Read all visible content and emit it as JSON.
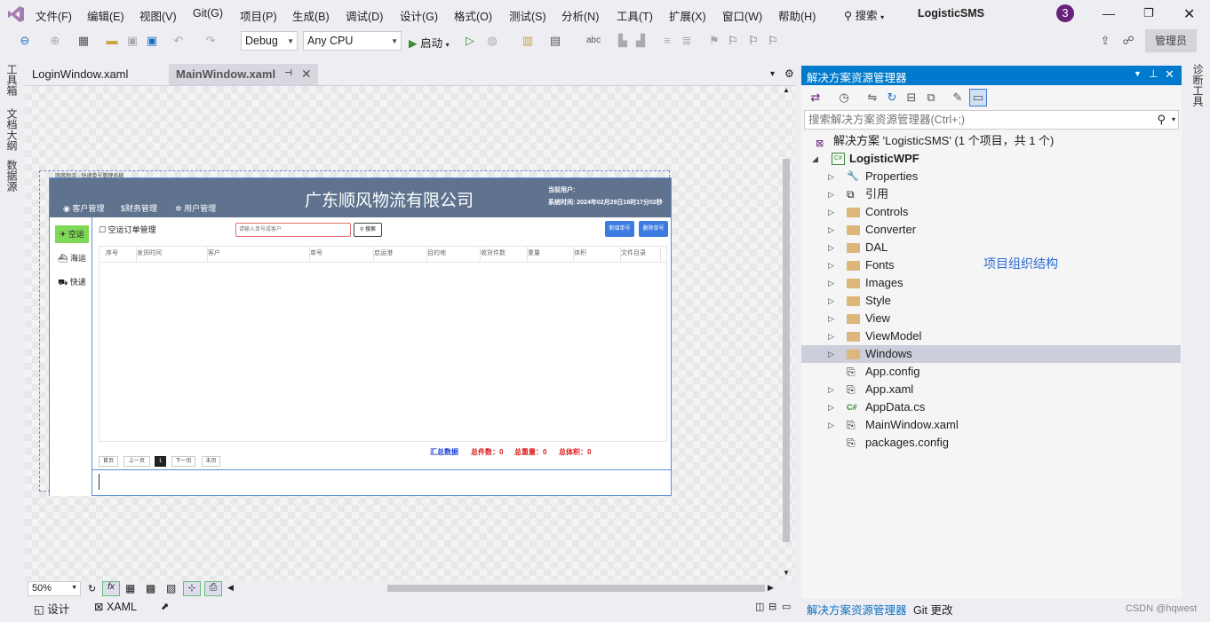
{
  "menu": {
    "items": [
      "文件(F)",
      "编辑(E)",
      "视图(V)",
      "Git(G)",
      "项目(P)",
      "生成(B)",
      "调试(D)",
      "设计(G)",
      "格式(O)",
      "测试(S)",
      "分析(N)",
      "工具(T)",
      "扩展(X)",
      "窗口(W)",
      "帮助(H)"
    ],
    "search": "搜索",
    "app_title": "LogisticSMS",
    "notification_count": "3",
    "admin_label": "管理员"
  },
  "toolbar": {
    "config": "Debug",
    "platform": "Any CPU",
    "start_label": "启动"
  },
  "left_side_tabs": [
    "工具箱",
    "文档大纲",
    "数据源"
  ],
  "right_side_tabs": [
    "诊断工具"
  ],
  "editor_tabs": [
    {
      "label": "LoginWindow.xaml"
    },
    {
      "label": "MainWindow.xaml"
    }
  ],
  "wpf_window": {
    "title_caption": "顺风物流 - 快递单号管理系统",
    "company_title": "广东顺风物流有限公司",
    "current_user_label": "当前用户:",
    "system_time": "系统时间:  2024年02月29日16时17分02秒",
    "top_nav": [
      "客户管理",
      "财务管理",
      "用户管理"
    ],
    "side_nav": [
      "空运",
      "海运",
      "快递"
    ],
    "section_title": "空运订单管理",
    "search_placeholder": "请输入单号或客户",
    "search_button": "搜索",
    "add_button": "新增单号",
    "delete_button": "删除单号",
    "columns": [
      "序号",
      "发货时间",
      "客户",
      "单号",
      "启运港",
      "目的地",
      "收货件数",
      "重量",
      "体积",
      "文件目录"
    ],
    "pager": [
      "首页",
      "上一页",
      "1",
      "下一页",
      "末页"
    ],
    "summary": {
      "label": "汇总数据",
      "total_count": "总件数：0",
      "total_weight": "总重量：0",
      "total_volume": "总体积：0"
    }
  },
  "designer_bottom": {
    "zoom": "50%",
    "design_tab": "设计",
    "xaml_tab": "XAML"
  },
  "solution_explorer": {
    "title": "解决方案资源管理器",
    "search_placeholder": "搜索解决方案资源管理器(Ctrl+;)",
    "solution": "解决方案 'LogisticSMS' (1 个项目，共 1 个)",
    "project": "LogisticWPF",
    "items": [
      {
        "label": "Properties",
        "type": "wrench",
        "expandable": true
      },
      {
        "label": "引用",
        "type": "ref",
        "expandable": true
      },
      {
        "label": "Controls",
        "type": "folder",
        "expandable": true
      },
      {
        "label": "Converter",
        "type": "folder",
        "expandable": true
      },
      {
        "label": "DAL",
        "type": "folder",
        "expandable": true
      },
      {
        "label": "Fonts",
        "type": "folder",
        "expandable": true
      },
      {
        "label": "Images",
        "type": "folder",
        "expandable": true
      },
      {
        "label": "Style",
        "type": "folder",
        "expandable": true
      },
      {
        "label": "View",
        "type": "folder",
        "expandable": true
      },
      {
        "label": "ViewModel",
        "type": "folder",
        "expandable": true
      },
      {
        "label": "Windows",
        "type": "folder",
        "expandable": true,
        "selected": true
      },
      {
        "label": "App.config",
        "type": "config",
        "expandable": false
      },
      {
        "label": "App.xaml",
        "type": "xaml",
        "expandable": true
      },
      {
        "label": "AppData.cs",
        "type": "cs",
        "expandable": true
      },
      {
        "label": "MainWindow.xaml",
        "type": "xaml",
        "expandable": true
      },
      {
        "label": "packages.config",
        "type": "config",
        "expandable": false
      }
    ],
    "annotation": "项目组织结构",
    "bottom_tabs": [
      "解决方案资源管理器",
      "Git 更改"
    ]
  },
  "watermark": "CSDN @hqwest",
  "colors": {
    "accent": "#007acc",
    "wpf_header": "#5f738f",
    "wpf_button": "#3d7be0",
    "active_nav": "#7ed957",
    "annotation": "#2b6cd4"
  }
}
